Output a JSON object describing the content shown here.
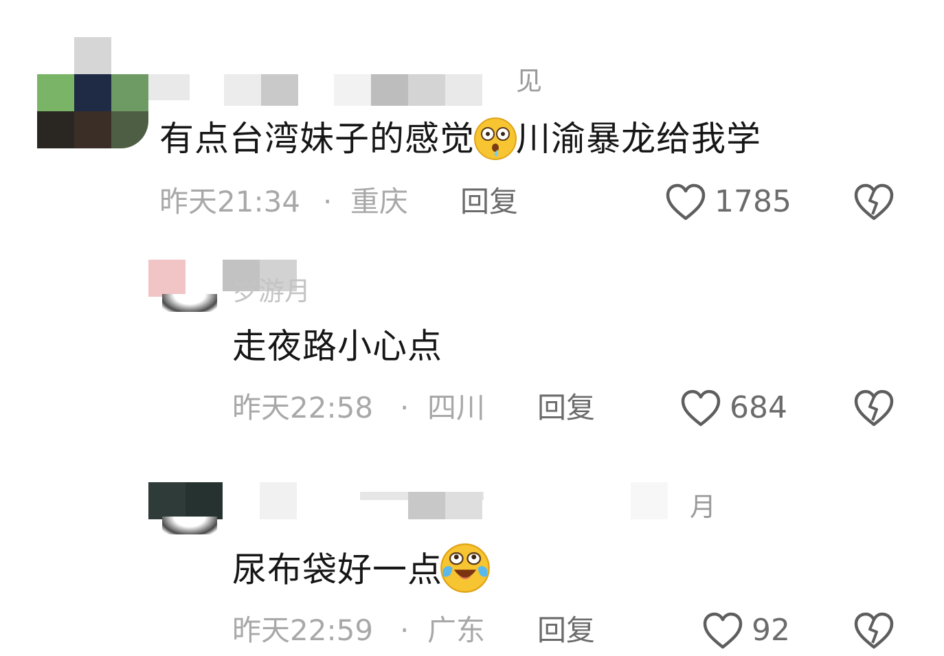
{
  "colors": {
    "text_primary": "#161616",
    "meta_gray": "#a8a8a8",
    "action_gray": "#6b6b6b",
    "emoji_yellow": "#f7c531"
  },
  "comments": [
    {
      "name_fragment": "见",
      "text_before_emoji": "有点台湾妹子的感觉",
      "emoji": "drooling-shocked-emoji",
      "text_after_emoji": "川渝暴龙给我学",
      "time": "昨天21:34",
      "sep": "·",
      "location": "重庆",
      "reply_label": "回复",
      "likes": "1785"
    },
    {
      "name_fragment": "岁游月",
      "text": "走夜路小心点",
      "time": "昨天22:58",
      "sep": "·",
      "location": "四川",
      "reply_label": "回复",
      "likes": "684"
    },
    {
      "name_fragment": "月",
      "text": "尿布袋好一点",
      "emoji": "laugh-cry-emoji",
      "time": "昨天22:59",
      "sep": "·",
      "location": "广东",
      "reply_label": "回复",
      "likes": "92"
    }
  ]
}
